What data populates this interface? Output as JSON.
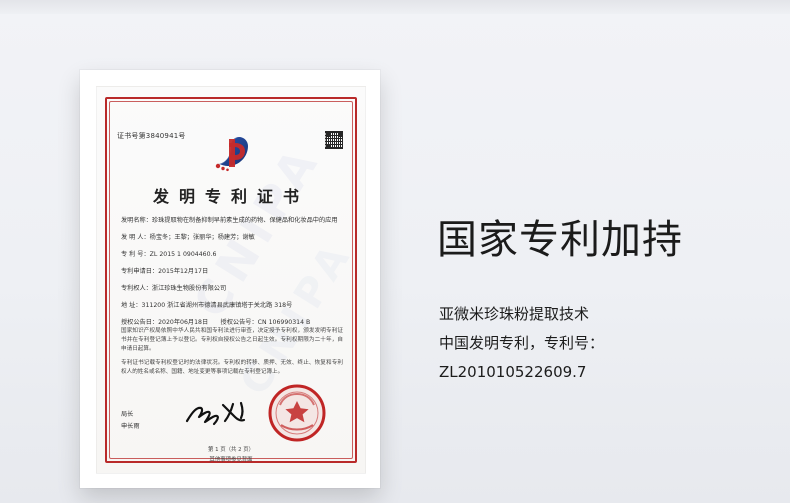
{
  "right_panel": {
    "headline": "国家专利加持",
    "lines": [
      "亚微米珍珠粉提取技术",
      "中国发明专利，专利号：",
      "ZL201010522609.7"
    ]
  },
  "certificate": {
    "number": "证书号第3840941号",
    "title": "发明专利证书",
    "fields": [
      "发明名称：珍珠提取物在制备抑制早前素生成的药物、保健品和化妆品中的应用",
      "发 明 人：杨宝冬；王黎；张丽华；杨建芳；谢敏",
      "专 利 号：ZL 2015 1 0904460.6",
      "专利申请日：2015年12月17日",
      "专利权人：浙江珍珠生物股份有限公司",
      "地    址：311200 浙江省湖州市德清县武康镇塔于关北路 318号",
      "授权公告日：2020年06月18日　　授权公告号：CN 106990314 B"
    ],
    "paragraphs": [
      "国家知识产权局依照中华人民共和国专利法进行审查，决定授予专利权，颁发发明专利证书并在专利登记簿上予以登记。专利权自授权公告之日起生效。专利权期限为二十年，自申请日起算。",
      "专利证书记载专利权登记时的法律状况。专利权的转移、质押、无效、终止、恢复和专利权人的姓名或名称、国籍、地址变更等事项记载在专利登记簿上。"
    ],
    "signature_labels": [
      "局长",
      "申长雨"
    ],
    "footer": [
      "第 1 页（共 2 页）",
      "其他事项参见背面"
    ],
    "seal_text": "国家知识产权局",
    "watermark_text": "CNIPA"
  },
  "colors": {
    "certificate_red": "#b92a2a",
    "headline_text": "#1b1b1b",
    "body_text": "#333333"
  }
}
